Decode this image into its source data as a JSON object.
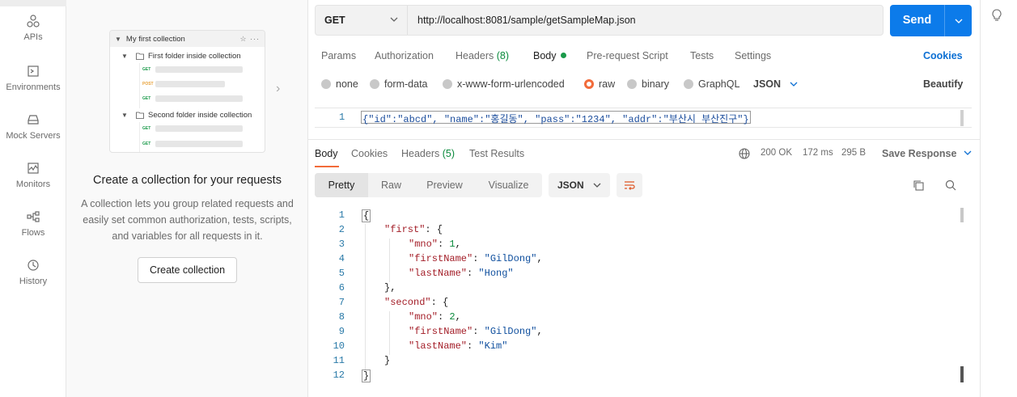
{
  "nav": {
    "items": [
      {
        "label": "APIs",
        "icon": "apis-icon"
      },
      {
        "label": "Environments",
        "icon": "environments-icon"
      },
      {
        "label": "Mock Servers",
        "icon": "mock-servers-icon"
      },
      {
        "label": "Monitors",
        "icon": "monitors-icon"
      },
      {
        "label": "Flows",
        "icon": "flows-icon"
      },
      {
        "label": "History",
        "icon": "history-icon"
      }
    ]
  },
  "collection_panel": {
    "preview": {
      "title": "My first collection",
      "folder1": "First folder inside collection",
      "folder2": "Second folder inside collection",
      "method_get": "GET",
      "method_post": "POST"
    },
    "heading": "Create a collection for your requests",
    "description": "A collection lets you group related requests and easily set common authorization, tests, scripts, and variables for all requests in it.",
    "button": "Create collection"
  },
  "request": {
    "method": "GET",
    "url": "http://localhost:8081/sample/getSampleMap.json",
    "send_label": "Send",
    "tabs": {
      "params": "Params",
      "authorization": "Authorization",
      "headers": "Headers",
      "headers_count": "(8)",
      "body": "Body",
      "prerequest": "Pre-request Script",
      "tests": "Tests",
      "settings": "Settings",
      "cookies": "Cookies"
    },
    "body_types": {
      "none": "none",
      "form_data": "form-data",
      "urlencoded": "x-www-form-urlencoded",
      "raw": "raw",
      "binary": "binary",
      "graphql": "GraphQL",
      "format": "JSON",
      "beautify": "Beautify"
    },
    "raw_body_line": "1",
    "raw_body": "{\"id\":\"abcd\", \"name\":\"홍길동\", \"pass\":\"1234\", \"addr\":\"부산시 부산진구\"}"
  },
  "response": {
    "tabs": {
      "body": "Body",
      "cookies": "Cookies",
      "headers": "Headers",
      "headers_count": "(5)",
      "test_results": "Test Results"
    },
    "status": "200 OK",
    "time": "172 ms",
    "size": "295 B",
    "save": "Save Response",
    "views": {
      "pretty": "Pretty",
      "raw": "Raw",
      "preview": "Preview",
      "visualize": "Visualize",
      "format": "JSON"
    },
    "lines": [
      "1",
      "2",
      "3",
      "4",
      "5",
      "6",
      "7",
      "8",
      "9",
      "10",
      "11",
      "12"
    ],
    "json": {
      "first_key": "\"first\"",
      "mno": "\"mno\"",
      "first_mno": "1",
      "firstName": "\"firstName\"",
      "first_firstName": "\"GilDong\"",
      "lastName": "\"lastName\"",
      "first_lastName": "\"Hong\"",
      "second_key": "\"second\"",
      "second_mno": "2",
      "second_firstName": "\"GilDong\"",
      "second_lastName": "\"Kim\""
    }
  },
  "colors": {
    "accent": "#0c7bea",
    "active_tab": "#f26b3a",
    "status_ok": "#0a8a3c"
  }
}
